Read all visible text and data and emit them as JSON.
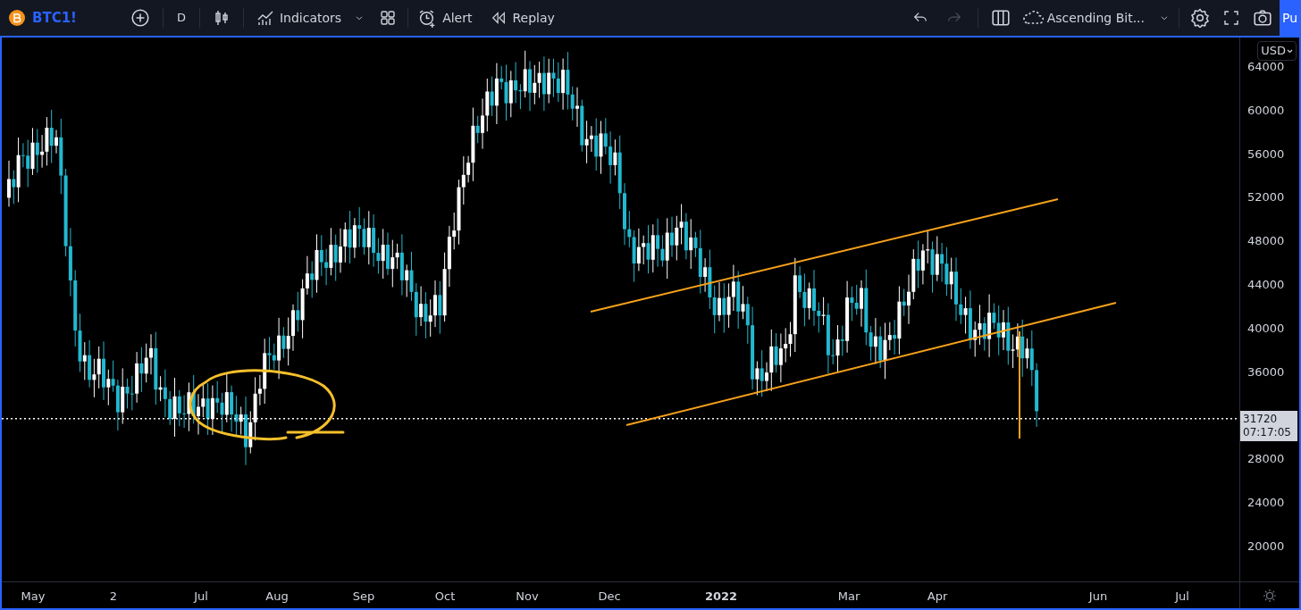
{
  "toolbar": {
    "symbol": "BTC1!",
    "interval": "D",
    "indicators": "Indicators",
    "alert": "Alert",
    "replay": "Replay",
    "undo": {
      "disabled": false
    },
    "redo": {
      "disabled": true
    },
    "layout_name": "Ascending Bit...",
    "publish": "Pu"
  },
  "chart": {
    "currency": "USD",
    "price_labels": [
      "64000",
      "60000",
      "56000",
      "52000",
      "48000",
      "44000",
      "40000",
      "36000",
      "28000",
      "24000",
      "20000"
    ],
    "last_price": "31720",
    "countdown": "07:17:05",
    "time_labels": [
      {
        "label": "May",
        "kind": "month"
      },
      {
        "label": "2",
        "kind": "month"
      },
      {
        "label": "Jul",
        "kind": "month"
      },
      {
        "label": "Aug",
        "kind": "month"
      },
      {
        "label": "Sep",
        "kind": "month"
      },
      {
        "label": "Oct",
        "kind": "month"
      },
      {
        "label": "Nov",
        "kind": "month"
      },
      {
        "label": "Dec",
        "kind": "month"
      },
      {
        "label": "2022",
        "kind": "year"
      },
      {
        "label": "Mar",
        "kind": "month"
      },
      {
        "label": "Apr",
        "kind": "month"
      },
      {
        "label": "Jun",
        "kind": "month"
      },
      {
        "label": "Jul",
        "kind": "month"
      }
    ]
  }
}
